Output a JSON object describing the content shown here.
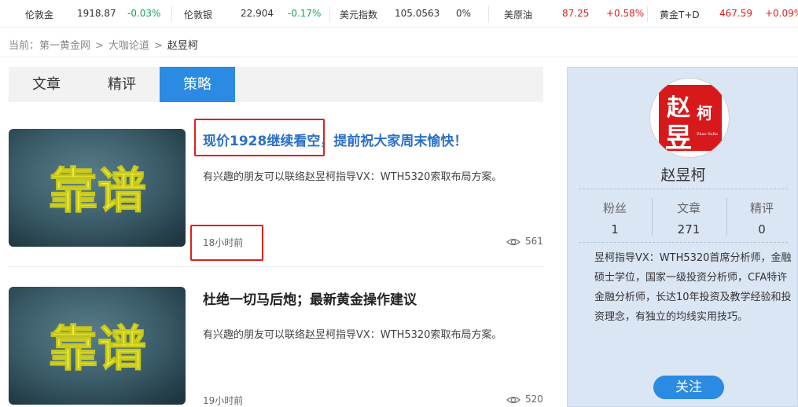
{
  "ticker": [
    {
      "name": "伦敦金",
      "price": "1918.87",
      "change": "-0.03%"
    },
    {
      "name": "伦敦银",
      "price": "22.904",
      "change": "-0.17%"
    },
    {
      "name": "美元指数",
      "price": "105.0563",
      "change": "0%"
    },
    {
      "name": "美原油",
      "price": "87.25",
      "change": "+0.58%"
    },
    {
      "name": "黄金T+D",
      "price": "467.59",
      "change": "+0.09%"
    }
  ],
  "breadcrumb": {
    "prefix": "当前：",
    "items": [
      "第一黄金网",
      "大咖论道"
    ],
    "current": "赵昱柯",
    "separator": ">"
  },
  "tabs": [
    "文章",
    "精评",
    "策略"
  ],
  "active_tab": "策略",
  "articles": [
    {
      "thumb_text": "靠谱",
      "title": "现价1928继续看空，提前祝大家周末愉快！",
      "desc": "有兴趣的朋友可以联络赵昱柯指导VX：WTH5320索取布局方案。",
      "time": "18小时前",
      "views": "561"
    },
    {
      "thumb_text": "靠谱",
      "title": "杜绝一切马后炮；最新黄金操作建议",
      "desc": "有兴趣的朋友可以联络赵昱柯指导VX：WTH5320索取布局方案。",
      "time": "19小时前",
      "views": "520"
    }
  ],
  "profile": {
    "seal": {
      "chars": [
        "赵",
        "昱",
        "柯"
      ],
      "sub": "Zhao YuKe"
    },
    "name": "赵昱柯",
    "stats": [
      {
        "label": "粉丝",
        "value": "1"
      },
      {
        "label": "文章",
        "value": "271"
      },
      {
        "label": "精评",
        "value": "0"
      }
    ],
    "bio": "昱柯指导VX：WTH5320首席分析师，金融硕士学位，国家一级投资分析师，CFA特许金融分析师，长达10年投资及教学经验和投资理念，有独立的均线实用技巧。",
    "follow_label": "关注"
  },
  "colors": {
    "accent": "#2b8ae2",
    "up": "#e02020",
    "down": "#1a9e5a",
    "highlight": "#e0201c",
    "sidebar_bg": "#dbe6f5"
  },
  "icons": {
    "views": "eye-icon"
  }
}
